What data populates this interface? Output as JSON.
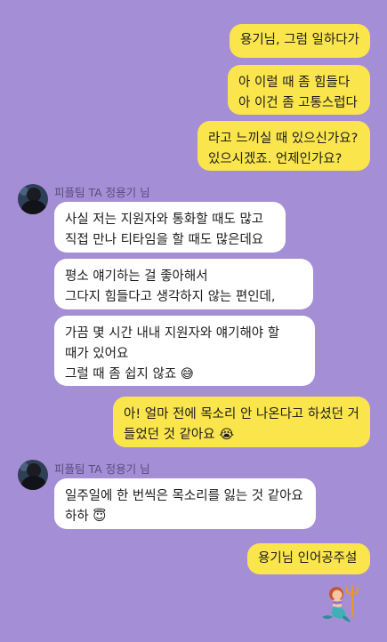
{
  "chat": {
    "sender_name": "피플팀 TA 정용기 님",
    "messages": [
      {
        "from": "me",
        "text": "용기님, 그럼 일하다가"
      },
      {
        "from": "me",
        "text": "아 이럴 때 좀 힘들다\n아 이건 좀 고통스럽다"
      },
      {
        "from": "me",
        "text": "라고 느끼실 때 있으신가요?\n있으시겠죠. 언제인가요?"
      },
      {
        "from": "them",
        "text": "사실 저는 지원자와 통화할 때도 많고\n직접 만나 티타임을 할 때도 많은데요"
      },
      {
        "from": "them",
        "text": "평소 얘기하는 걸 좋아해서\n그다지 힘들다고 생각하지 않는 편인데,"
      },
      {
        "from": "them",
        "text": "가끔 몇 시간 내내 지원자와 얘기해야 할\n때가 있어요\n그럴 때 좀 쉽지 않죠 😅"
      },
      {
        "from": "me",
        "text": "아! 얼마 전에 목소리 안 나온다고 하셨던 거\n들었던 것 같아요 😭"
      },
      {
        "from": "them",
        "text": "일주일에 한 번씩은 목소리를 잃는 것 같아요\n하하 😇"
      },
      {
        "from": "me",
        "text": "용기님 인어공주설"
      }
    ],
    "sticker": "mermaid-emoji"
  },
  "colors": {
    "background": "#a48fd6",
    "my_bubble": "#fbe54d",
    "their_bubble": "#ffffff"
  }
}
